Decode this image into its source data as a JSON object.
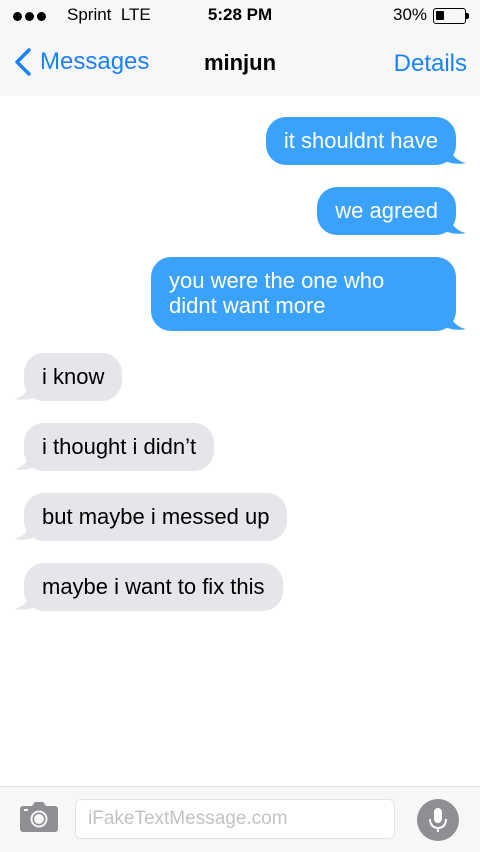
{
  "status_bar": {
    "carrier": "Sprint  LTE",
    "time": "5:28 PM",
    "battery_percent": "30%",
    "battery_level": 0.3
  },
  "nav": {
    "back_label": "Messages",
    "title": "minjun",
    "details_label": "Details",
    "accent_color": "#1a82fb"
  },
  "messages": [
    {
      "direction": "sent",
      "text": "it shouldnt have"
    },
    {
      "direction": "sent",
      "text": "we agreed"
    },
    {
      "direction": "sent",
      "text": "you were the one who didnt want more"
    },
    {
      "direction": "received",
      "text": "i know"
    },
    {
      "direction": "received",
      "text": "i thought i didn’t"
    },
    {
      "direction": "received",
      "text": "but maybe i messed up"
    },
    {
      "direction": "received",
      "text": "maybe i want to fix this"
    }
  ],
  "colors": {
    "sent_bubble": "#3ba2fb",
    "received_bubble": "#e5e5ea"
  },
  "input_bar": {
    "placeholder": "iFakeTextMessage.com",
    "camera_icon": "camera-icon",
    "mic_icon": "microphone-icon"
  }
}
